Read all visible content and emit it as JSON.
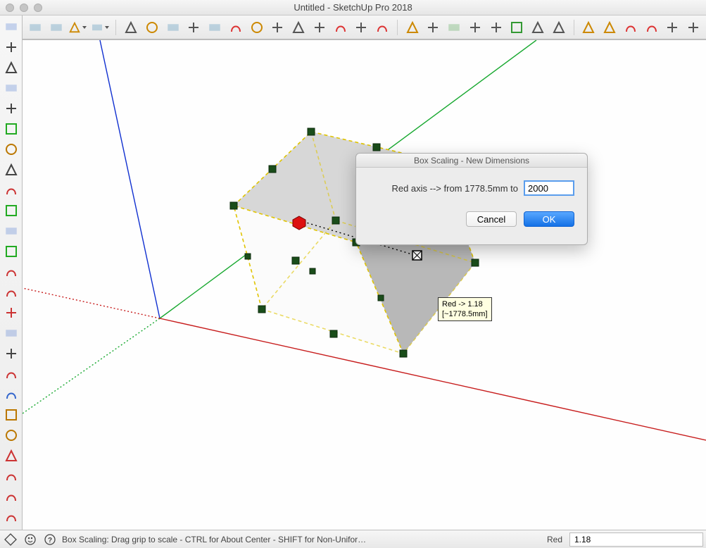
{
  "window": {
    "title": "Untitled - SketchUp Pro 2018"
  },
  "dialog": {
    "title": "Box Scaling - New Dimensions",
    "prompt": "Red axis --> from 1778.5mm to",
    "value": "2000",
    "cancel": "Cancel",
    "ok": "OK"
  },
  "tooltip": {
    "line1": "Red -> 1.18",
    "line2": "[~1778.5mm]"
  },
  "status": {
    "hint": "Box Scaling: Drag grip to scale - CTRL for About Center - SHIFT for Non-Unifor…",
    "vcb_label": "Red",
    "vcb_value": "1.18"
  },
  "top_tools": [
    "eraser-tool",
    "pencil-tool",
    "arc-tool",
    "shapes-tool",
    "rectangle-tool",
    "pushpull-tool",
    "offset-tool",
    "move-tool",
    "rotate-tool",
    "scale-tool",
    "followme-tool",
    "tape-tool",
    "dimension-tool",
    "text-tool",
    "paint-tool",
    "axes-tool",
    "orbit-tool",
    "pan-tool",
    "zoom-tool",
    "zoom-extents-tool",
    "walk-tool",
    "look-tool",
    "section-tool",
    "component-tool",
    "warehouse-tool",
    "view-iso",
    "view-top",
    "view-front",
    "view-right",
    "view-back",
    "view-left"
  ],
  "left_tools": [
    "select-tool",
    "line-tool",
    "rectangle-tool",
    "circle-tool",
    "arc2-tool",
    "polygon-tool",
    "freehand-tool",
    "pushpull2-tool",
    "move2-tool",
    "rotate2-tool",
    "scale2-tool",
    "offset2-tool",
    "tape2-tool",
    "axes2-tool",
    "protractor-tool",
    "orbit2-tool",
    "pan2-tool",
    "zoom2-tool",
    "zoom-window-tool",
    "zoom-extents2-tool",
    "section2-tool",
    "position-camera-tool",
    "walk2-tool",
    "look2-tool",
    "scene-tool"
  ]
}
